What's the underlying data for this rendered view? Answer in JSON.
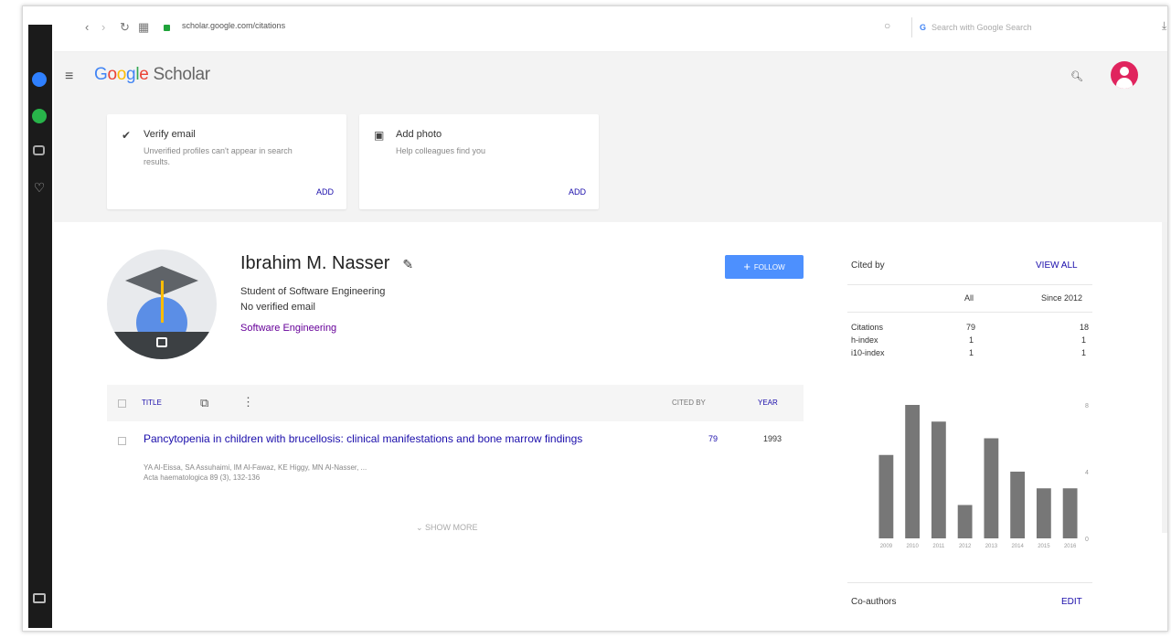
{
  "browser": {
    "url": "scholar.google.com/citations",
    "search_placeholder": "Search with Google Search"
  },
  "header": {
    "logo_letters": [
      "G",
      "o",
      "o",
      "g",
      "l",
      "e"
    ],
    "logo_suffix": " Scholar"
  },
  "cards": [
    {
      "title": "Verify email",
      "desc": "Unverified profiles can't appear in search results.",
      "action": "ADD"
    },
    {
      "title": "Add photo",
      "desc": "Help colleagues find you",
      "action": "ADD"
    }
  ],
  "profile": {
    "name": "Ibrahim M. Nasser",
    "affiliation": "Student of Software Engineering",
    "email": "No verified email",
    "interest": "Software Engineering",
    "follow_label": "FOLLOW"
  },
  "table": {
    "headers": {
      "title": "TITLE",
      "cited_by": "CITED BY",
      "year": "YEAR"
    },
    "rows": [
      {
        "title": "Pancytopenia in children with brucellosis: clinical manifestations and bone marrow findings",
        "authors": "YA Al-Eissa, SA Assuhaimi, IM Al-Fawaz, KE Higgy, MN Al-Nasser, ...",
        "journal": "Acta haematologica 89 (3), 132-136",
        "cited": "79",
        "year": "1993"
      }
    ],
    "show_more": "SHOW MORE"
  },
  "cited_by": {
    "title": "Cited by",
    "view_all": "VIEW ALL",
    "col_all": "All",
    "col_since": "Since 2012",
    "stats": [
      {
        "label": "Citations",
        "all": "79",
        "since": "18"
      },
      {
        "label": "h-index",
        "all": "1",
        "since": "1"
      },
      {
        "label": "i10-index",
        "all": "1",
        "since": "1"
      }
    ]
  },
  "chart_data": {
    "type": "bar",
    "categories": [
      "2009",
      "2010",
      "2011",
      "2012",
      "2013",
      "2014",
      "2015",
      "2016"
    ],
    "values": [
      5,
      8,
      7,
      2,
      6,
      4,
      3,
      3
    ],
    "yticks": [
      "8",
      "4",
      "0"
    ],
    "ylim": [
      0,
      8
    ]
  },
  "coauthors": {
    "title": "Co-authors",
    "edit": "EDIT"
  },
  "colors": {
    "link": "#1a0dab",
    "follow": "#4d90fe",
    "interest": "#660099",
    "bar": "#777777"
  }
}
